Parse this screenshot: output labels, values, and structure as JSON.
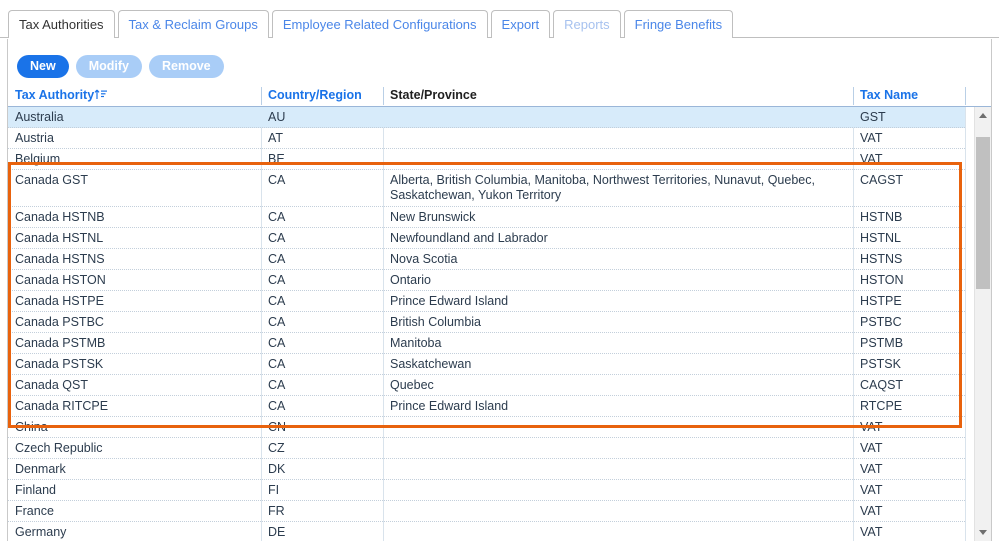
{
  "tabs": [
    {
      "label": "Tax Authorities",
      "state": "active"
    },
    {
      "label": "Tax & Reclaim Groups",
      "state": "normal"
    },
    {
      "label": "Employee Related Configurations",
      "state": "normal"
    },
    {
      "label": "Export",
      "state": "normal"
    },
    {
      "label": "Reports",
      "state": "muted"
    },
    {
      "label": "Fringe Benefits",
      "state": "normal"
    }
  ],
  "toolbar": {
    "new_label": "New",
    "modify_label": "Modify",
    "remove_label": "Remove"
  },
  "grid": {
    "columns": [
      {
        "label": "Tax Authority",
        "sorted": true,
        "sort_icon": "sort-ascending-icon"
      },
      {
        "label": "Country/Region",
        "sorted": false
      },
      {
        "label": "State/Province",
        "sorted": false
      },
      {
        "label": "Tax Name",
        "sorted": false
      }
    ],
    "rows": [
      {
        "authority": "Australia",
        "country": "AU",
        "state": "",
        "tax_name": "GST",
        "selected": true
      },
      {
        "authority": "Austria",
        "country": "AT",
        "state": "",
        "tax_name": "VAT",
        "selected": false
      },
      {
        "authority": "Belgium",
        "country": "BE",
        "state": "",
        "tax_name": "VAT",
        "selected": false
      },
      {
        "authority": "Canada GST",
        "country": "CA",
        "state": "Alberta, British Columbia, Manitoba, Northwest Territories, Nunavut, Quebec,\nSaskatchewan, Yukon Territory",
        "tax_name": "CAGST",
        "selected": false,
        "tall": true
      },
      {
        "authority": "Canada HSTNB",
        "country": "CA",
        "state": "New Brunswick",
        "tax_name": "HSTNB",
        "selected": false
      },
      {
        "authority": "Canada HSTNL",
        "country": "CA",
        "state": "Newfoundland and Labrador",
        "tax_name": "HSTNL",
        "selected": false
      },
      {
        "authority": "Canada HSTNS",
        "country": "CA",
        "state": "Nova Scotia",
        "tax_name": "HSTNS",
        "selected": false
      },
      {
        "authority": "Canada HSTON",
        "country": "CA",
        "state": "Ontario",
        "tax_name": "HSTON",
        "selected": false
      },
      {
        "authority": "Canada HSTPE",
        "country": "CA",
        "state": "Prince Edward Island",
        "tax_name": "HSTPE",
        "selected": false
      },
      {
        "authority": "Canada PSTBC",
        "country": "CA",
        "state": "British Columbia",
        "tax_name": "PSTBC",
        "selected": false
      },
      {
        "authority": "Canada PSTMB",
        "country": "CA",
        "state": "Manitoba",
        "tax_name": "PSTMB",
        "selected": false
      },
      {
        "authority": "Canada PSTSK",
        "country": "CA",
        "state": "Saskatchewan",
        "tax_name": "PSTSK",
        "selected": false
      },
      {
        "authority": "Canada QST",
        "country": "CA",
        "state": "Quebec",
        "tax_name": "CAQST",
        "selected": false
      },
      {
        "authority": "Canada RITCPE",
        "country": "CA",
        "state": "Prince Edward Island",
        "tax_name": "RTCPE",
        "selected": false
      },
      {
        "authority": "China",
        "country": "CN",
        "state": "",
        "tax_name": "VAT",
        "selected": false
      },
      {
        "authority": "Czech Republic",
        "country": "CZ",
        "state": "",
        "tax_name": "VAT",
        "selected": false
      },
      {
        "authority": "Denmark",
        "country": "DK",
        "state": "",
        "tax_name": "VAT",
        "selected": false
      },
      {
        "authority": "Finland",
        "country": "FI",
        "state": "",
        "tax_name": "VAT",
        "selected": false
      },
      {
        "authority": "France",
        "country": "FR",
        "state": "",
        "tax_name": "VAT",
        "selected": false
      },
      {
        "authority": "Germany",
        "country": "DE",
        "state": "",
        "tax_name": "VAT",
        "selected": false
      }
    ]
  },
  "scrollbar": {
    "up_icon": "scroll-up-arrow-icon",
    "down_icon": "scroll-down-arrow-icon"
  },
  "annotation": {
    "color": "#e8620d",
    "shape": "rectangle-highlight"
  },
  "colors": {
    "accent": "#1a73e8",
    "tab_link": "#4a86e8",
    "selected_row": "#d7ebfa",
    "annotation": "#e8620d",
    "disabled_button": "#a9cdf7"
  }
}
